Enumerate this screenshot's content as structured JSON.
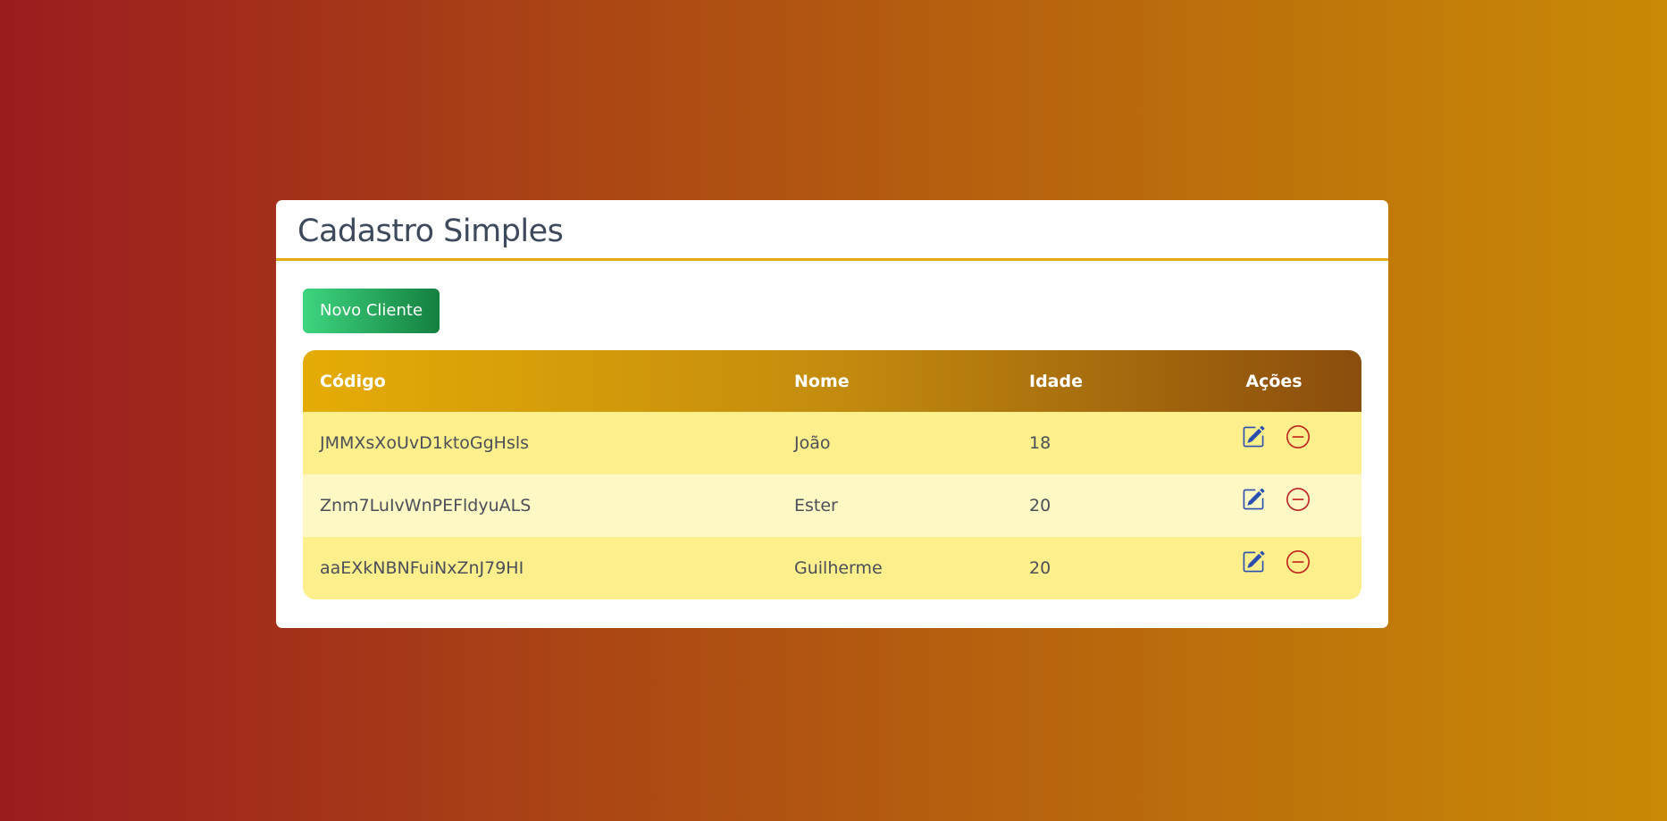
{
  "page": {
    "title": "Cadastro Simples"
  },
  "toolbar": {
    "new_client_label": "Novo Cliente"
  },
  "table": {
    "columns": [
      "Código",
      "Nome",
      "Idade",
      "Ações"
    ],
    "rows": [
      {
        "codigo": "JMMXsXoUvD1ktoGgHsls",
        "nome": "João",
        "idade": "18"
      },
      {
        "codigo": "Znm7LuIvWnPEFldyuALS",
        "nome": "Ester",
        "idade": "20"
      },
      {
        "codigo": "aaEXkNBNFuiNxZnJ79HI",
        "nome": "Guilherme",
        "idade": "20"
      }
    ],
    "row_actions": [
      {
        "name": "edit",
        "icon": "pencil-square-icon",
        "color": "#2a4fb0"
      },
      {
        "name": "delete",
        "icon": "dash-circle-icon",
        "color": "#c0231d"
      }
    ]
  },
  "colors": {
    "background_gradient": [
      "#9b1c1f",
      "#b45d0f",
      "#c98a06"
    ],
    "header_underline": "#e5ac0f",
    "new_button_gradient": [
      "#3ed57f",
      "#148040"
    ],
    "table_header_gradient": [
      "#e5ac06",
      "#c48c0e",
      "#8b4d0d"
    ],
    "row_odd": "#fdef8c",
    "row_even": "#fdf8c4"
  }
}
